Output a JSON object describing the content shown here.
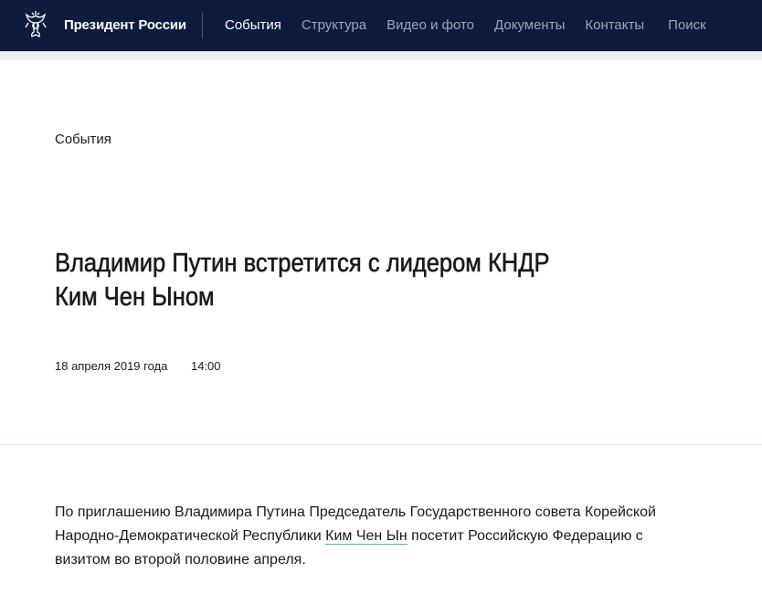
{
  "header": {
    "brand": "Президент России",
    "nav": [
      {
        "label": "События",
        "active": true
      },
      {
        "label": "Структура",
        "active": false
      },
      {
        "label": "Видео и фото",
        "active": false
      },
      {
        "label": "Документы",
        "active": false
      },
      {
        "label": "Контакты",
        "active": false
      },
      {
        "label": "Поиск",
        "active": false
      }
    ],
    "emblem_icon": "double-headed-eagle-icon"
  },
  "article": {
    "section": "События",
    "title": "Владимир Путин встретится с лидером КНДР Ким Чен Ыном",
    "date": "18 апреля 2019 года",
    "time": "14:00",
    "text_before": "По приглашению Владимира Путина Председатель Государственного совета Корейской Народно-Демократической Республики ",
    "link": "Ким Чен Ын",
    "text_after": " посетит Российскую Федерацию с визитом во второй половине апреля."
  },
  "colors": {
    "header_bg": "#0d1b3e",
    "nav_inactive": "#9aa4bd",
    "link_underline": "#3fbf8f",
    "divider": "#cfeee0"
  }
}
